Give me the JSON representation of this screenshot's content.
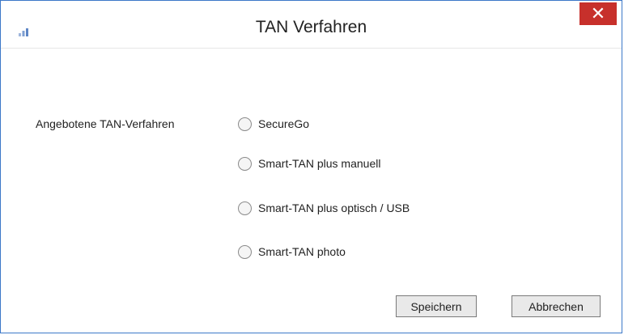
{
  "window": {
    "title": "TAN Verfahren",
    "close_label": "✕"
  },
  "form": {
    "group_label": "Angebotene TAN-Verfahren",
    "options": [
      {
        "label": "SecureGo",
        "selected": false
      },
      {
        "label": "Smart-TAN plus manuell",
        "selected": false
      },
      {
        "label": "Smart-TAN plus optisch / USB",
        "selected": false
      },
      {
        "label": "Smart-TAN photo",
        "selected": false
      }
    ]
  },
  "buttons": {
    "save_label": "Speichern",
    "cancel_label": "Abbrechen"
  },
  "icons": {
    "app": "signal-bars-icon",
    "close": "close-icon",
    "radio": "radio-icon"
  },
  "colors": {
    "close_bg": "#c7302b",
    "window_border": "#3c78c8",
    "app_icon": "#6a8fc8"
  }
}
